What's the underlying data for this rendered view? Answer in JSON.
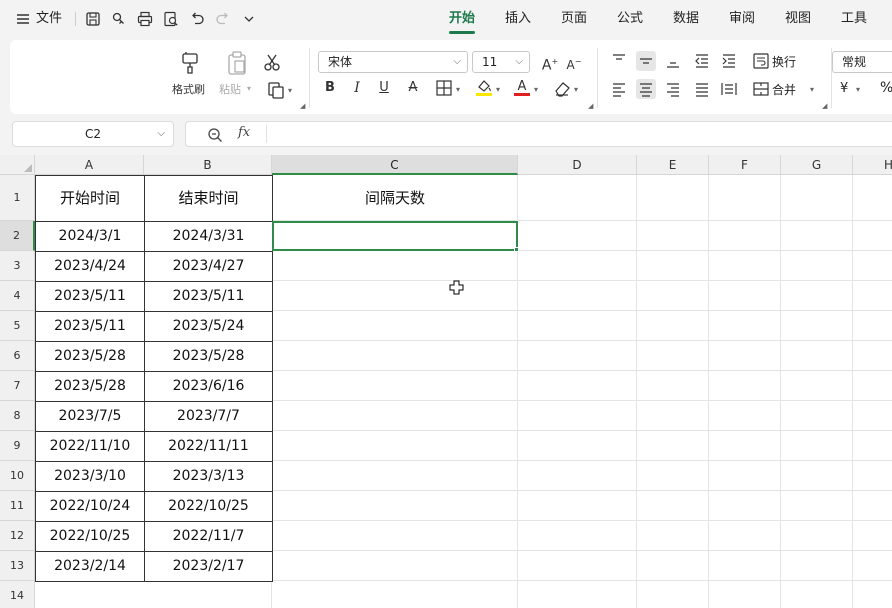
{
  "menubar": {
    "file_label": "文件",
    "tabs": [
      {
        "label": "开始",
        "active": true
      },
      {
        "label": "插入",
        "active": false
      },
      {
        "label": "页面",
        "active": false
      },
      {
        "label": "公式",
        "active": false
      },
      {
        "label": "数据",
        "active": false
      },
      {
        "label": "审阅",
        "active": false
      },
      {
        "label": "视图",
        "active": false
      },
      {
        "label": "工具",
        "active": false
      }
    ],
    "icons": [
      "menu-icon",
      "save-icon",
      "link-icon",
      "print-icon",
      "print-preview-icon",
      "undo-icon",
      "redo-icon",
      "chevron-down-icon"
    ]
  },
  "ribbon": {
    "format_painter_label": "格式刷",
    "paste_label": "粘贴",
    "font_name": "宋体",
    "font_size": "11",
    "wrap_label": "换行",
    "merge_label": "合并",
    "number_format": "常规",
    "currency_symbol": "¥",
    "percent_symbol": "%",
    "fill_color": "#ffe600",
    "font_color": "#e02020"
  },
  "formula_bar": {
    "cell_ref": "C2",
    "formula": ""
  },
  "sheet": {
    "columns": [
      "A",
      "B",
      "C",
      "D",
      "E",
      "F",
      "G",
      "H"
    ],
    "rows": [
      "1",
      "2",
      "3",
      "4",
      "5",
      "6",
      "7",
      "8",
      "9",
      "10",
      "11",
      "12",
      "13",
      "14"
    ],
    "selected_column": "C",
    "selected_row": "2",
    "headers": {
      "a": "开始时间",
      "b": "结束时间",
      "c": "间隔天数"
    },
    "data": [
      [
        "2024/3/1",
        "2024/3/31"
      ],
      [
        "2023/4/24",
        "2023/4/27"
      ],
      [
        "2023/5/11",
        "2023/5/11"
      ],
      [
        "2023/5/11",
        "2023/5/24"
      ],
      [
        "2023/5/28",
        "2023/5/28"
      ],
      [
        "2023/5/28",
        "2023/6/16"
      ],
      [
        "2023/7/5",
        "2023/7/7"
      ],
      [
        "2022/11/10",
        "2022/11/11"
      ],
      [
        "2023/3/10",
        "2023/3/13"
      ],
      [
        "2022/10/24",
        "2022/10/25"
      ],
      [
        "2022/10/25",
        "2022/11/7"
      ],
      [
        "2023/2/14",
        "2023/2/17"
      ]
    ]
  }
}
